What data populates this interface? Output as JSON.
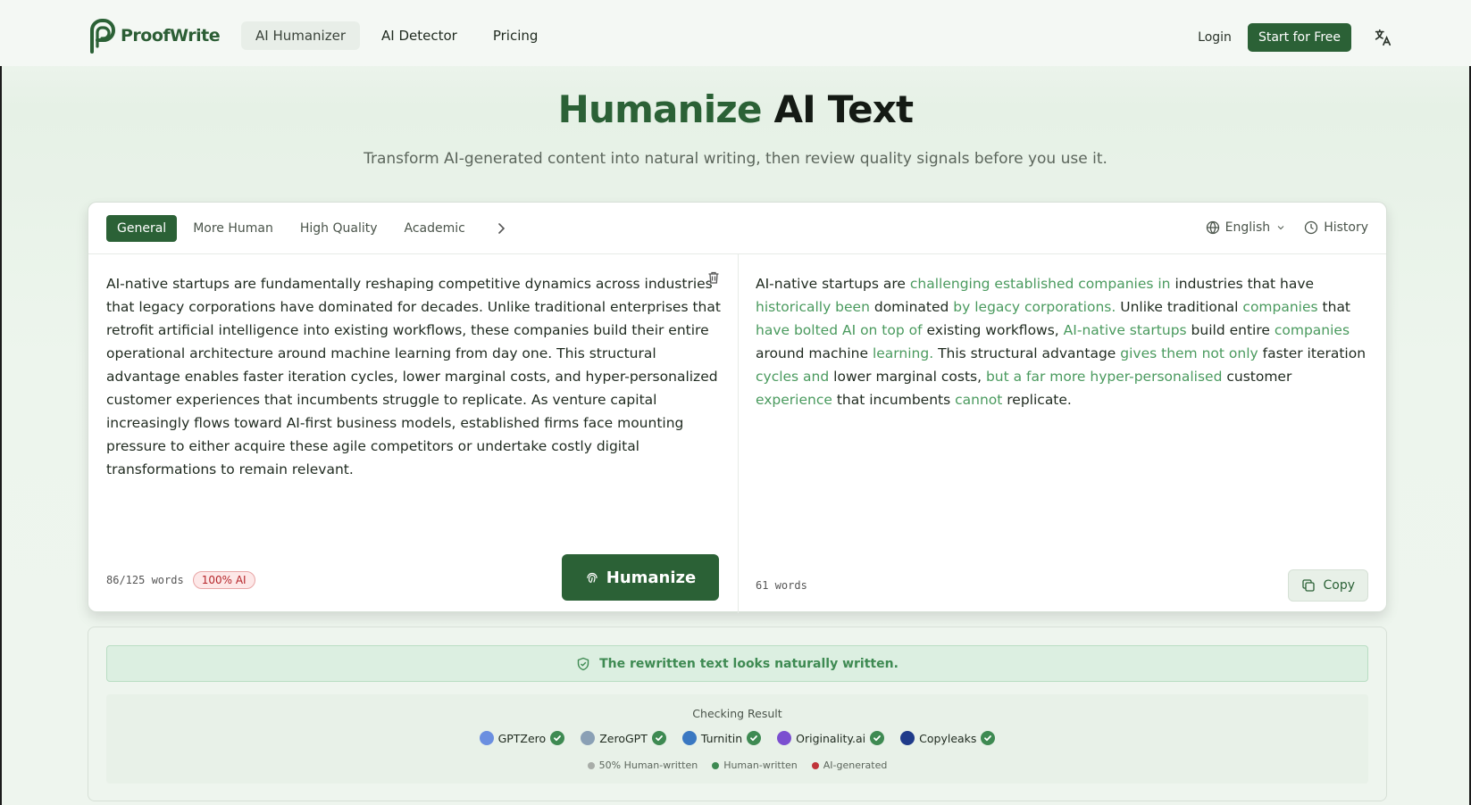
{
  "brand": {
    "name": "ProofWrite",
    "color": "#2b6136"
  },
  "nav": {
    "items": [
      {
        "label": "AI Humanizer",
        "active": true
      },
      {
        "label": "AI Detector",
        "active": false
      },
      {
        "label": "Pricing",
        "active": false
      }
    ],
    "login_label": "Login",
    "start_label": "Start for Free",
    "language_icon": "translate-icon"
  },
  "hero": {
    "title_accent": "Humanize",
    "title_rest": "AI Text",
    "subtitle": "Transform AI-generated content into natural writing, then review quality signals before you use it."
  },
  "editor": {
    "tabs": [
      {
        "label": "General",
        "active": true
      },
      {
        "label": "More Human",
        "active": false
      },
      {
        "label": "High Quality",
        "active": false
      },
      {
        "label": "Academic",
        "active": false
      }
    ],
    "language": "English",
    "history_label": "History",
    "input_text": "AI-native startups are fundamentally reshaping competitive dynamics across industries that legacy corporations have dominated for decades. Unlike traditional enterprises that retrofit artificial intelligence into existing workflows, these companies build their entire operational architecture around machine learning from day one. This structural advantage enables faster iteration cycles, lower marginal costs, and hyper-personalized customer experiences that incumbents struggle to replicate. As venture capital increasingly flows toward AI-first business models, established firms face mounting pressure to either acquire these agile competitors or undertake costly digital transformations to remain relevant.",
    "input_word_count": "86/125 words",
    "ai_badge": "100% AI",
    "humanize_label": "Humanize",
    "output_segments": [
      {
        "t": "AI-native startups are ",
        "hl": false
      },
      {
        "t": "challenging established companies in",
        "hl": true
      },
      {
        "t": " industries that have ",
        "hl": false
      },
      {
        "t": "historically been",
        "hl": true
      },
      {
        "t": " dominated ",
        "hl": false
      },
      {
        "t": "by legacy corporations.",
        "hl": true
      },
      {
        "t": " Unlike traditional ",
        "hl": false
      },
      {
        "t": "companies",
        "hl": true
      },
      {
        "t": " that ",
        "hl": false
      },
      {
        "t": "have bolted AI on top of",
        "hl": true
      },
      {
        "t": " existing workflows, ",
        "hl": false
      },
      {
        "t": "AI-native startups",
        "hl": true
      },
      {
        "t": " build entire ",
        "hl": false
      },
      {
        "t": "companies",
        "hl": true
      },
      {
        "t": " around machine ",
        "hl": false
      },
      {
        "t": "learning.",
        "hl": true
      },
      {
        "t": " This structural advantage ",
        "hl": false
      },
      {
        "t": "gives them not only",
        "hl": true
      },
      {
        "t": " faster iteration ",
        "hl": false
      },
      {
        "t": "cycles and",
        "hl": true
      },
      {
        "t": " lower marginal costs, ",
        "hl": false
      },
      {
        "t": "but a far more hyper-personalised",
        "hl": true
      },
      {
        "t": " customer ",
        "hl": false
      },
      {
        "t": "experience",
        "hl": true
      },
      {
        "t": " that incumbents ",
        "hl": false
      },
      {
        "t": "cannot",
        "hl": true
      },
      {
        "t": " replicate.",
        "hl": false
      }
    ],
    "output_word_count": "61 words",
    "copy_label": "Copy"
  },
  "result": {
    "banner": "The rewritten text looks naturally written.",
    "checking_title": "Checking Result",
    "detectors": [
      {
        "name": "GPTZero",
        "color": "#6b8fe0"
      },
      {
        "name": "ZeroGPT",
        "color": "#8aa0b5"
      },
      {
        "name": "Turnitin",
        "color": "#3a78c2"
      },
      {
        "name": "Originality.ai",
        "color": "#7b4fd0"
      },
      {
        "name": "Copyleaks",
        "color": "#1f3b8a"
      }
    ],
    "legend": [
      {
        "label": "50% Human-written",
        "color": "#a8ada8"
      },
      {
        "label": "Human-written",
        "color": "#3e8a52"
      },
      {
        "label": "AI-generated",
        "color": "#c0343a"
      }
    ]
  }
}
